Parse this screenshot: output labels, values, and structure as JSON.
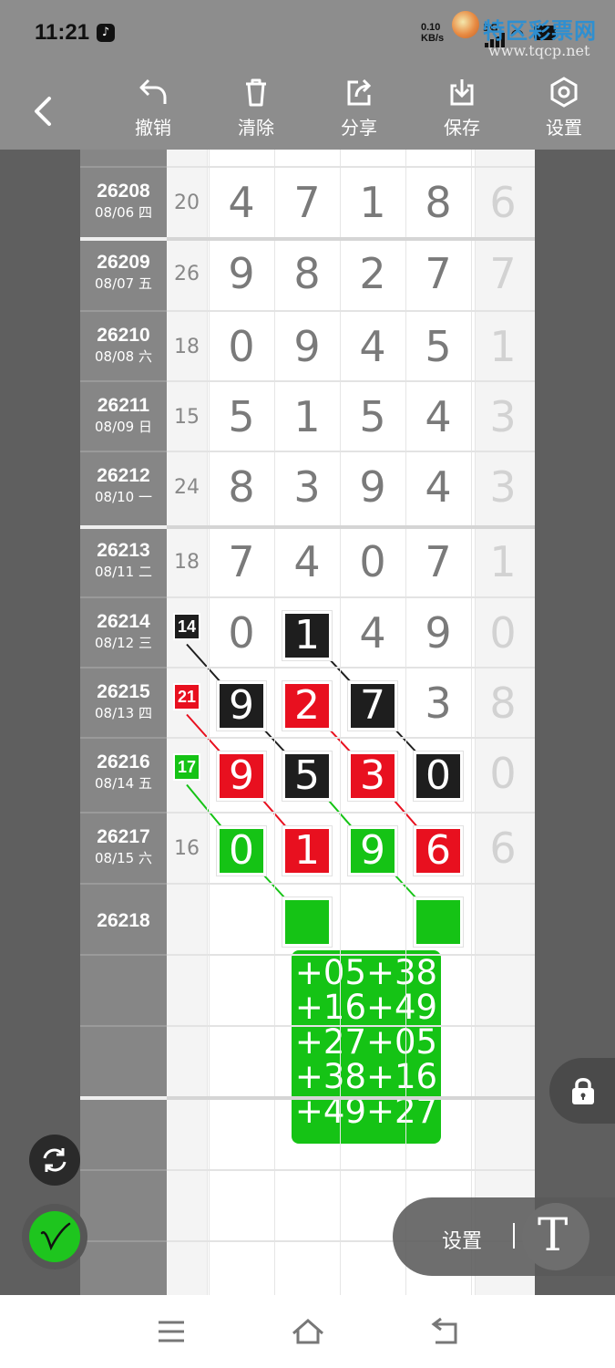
{
  "status": {
    "time": "11:21",
    "net_speed_value": "0.10",
    "net_speed_unit": "KB/s",
    "network": "5G",
    "watermark_title": "特区彩票网",
    "watermark_url": "www.tqcp.net"
  },
  "toolbar": {
    "undo_label": "撤销",
    "clear_label": "清除",
    "share_label": "分享",
    "save_label": "保存",
    "settings_label": "设置"
  },
  "rows": [
    {
      "period": "26208",
      "date": "08/06 四",
      "sum": "20",
      "digits": [
        "4",
        "7",
        "1",
        "8"
      ],
      "last": "6"
    },
    {
      "period": "26209",
      "date": "08/07 五",
      "sum": "26",
      "digits": [
        "9",
        "8",
        "2",
        "7"
      ],
      "last": "7"
    },
    {
      "period": "26210",
      "date": "08/08 六",
      "sum": "18",
      "digits": [
        "0",
        "9",
        "4",
        "5"
      ],
      "last": "1"
    },
    {
      "period": "26211",
      "date": "08/09 日",
      "sum": "15",
      "digits": [
        "5",
        "1",
        "5",
        "4"
      ],
      "last": "3"
    },
    {
      "period": "26212",
      "date": "08/10 一",
      "sum": "24",
      "digits": [
        "8",
        "3",
        "9",
        "4"
      ],
      "last": "3"
    },
    {
      "period": "26213",
      "date": "08/11 二",
      "sum": "18",
      "digits": [
        "7",
        "4",
        "0",
        "7"
      ],
      "last": "1"
    },
    {
      "period": "26214",
      "date": "08/12 三",
      "sum": "",
      "digits": [
        "0",
        "1",
        "4",
        "9"
      ],
      "last": "0"
    },
    {
      "period": "26215",
      "date": "08/13 四",
      "sum": "",
      "digits": [
        "9",
        "2",
        "7",
        "3"
      ],
      "last": "8"
    },
    {
      "period": "26216",
      "date": "08/14 五",
      "sum": "",
      "digits": [
        "9",
        "5",
        "3",
        "0"
      ],
      "last": "0"
    },
    {
      "period": "26217",
      "date": "08/15 六",
      "sum": "16",
      "digits": [
        "0",
        "1",
        "9",
        "6"
      ],
      "last": "6"
    },
    {
      "period": "26218",
      "date": "",
      "sum": "",
      "digits": [
        "",
        "",
        "",
        ""
      ],
      "last": ""
    }
  ],
  "markers": {
    "black_sum": "14",
    "red_sum": "21",
    "green_sum": "17"
  },
  "highlights": {
    "black": [
      "26214-1",
      "26215-0",
      "26215-2",
      "26216-1",
      "26216-3"
    ],
    "red": [
      "26215-1",
      "26216-0",
      "26216-2",
      "26217-1",
      "26217-3"
    ],
    "green": [
      "26217-0",
      "26217-2",
      "26218-1",
      "26218-3"
    ]
  },
  "colors": {
    "black_mark": "#1e1e1e",
    "red_mark": "#e8101f",
    "green_mark": "#15c315"
  },
  "result_lines": [
    "+05+38",
    "+16+49",
    "+27+05",
    "+38+16",
    "+49+27"
  ],
  "float_panel": {
    "settings_label": "设置",
    "text_tool_glyph": "T"
  }
}
